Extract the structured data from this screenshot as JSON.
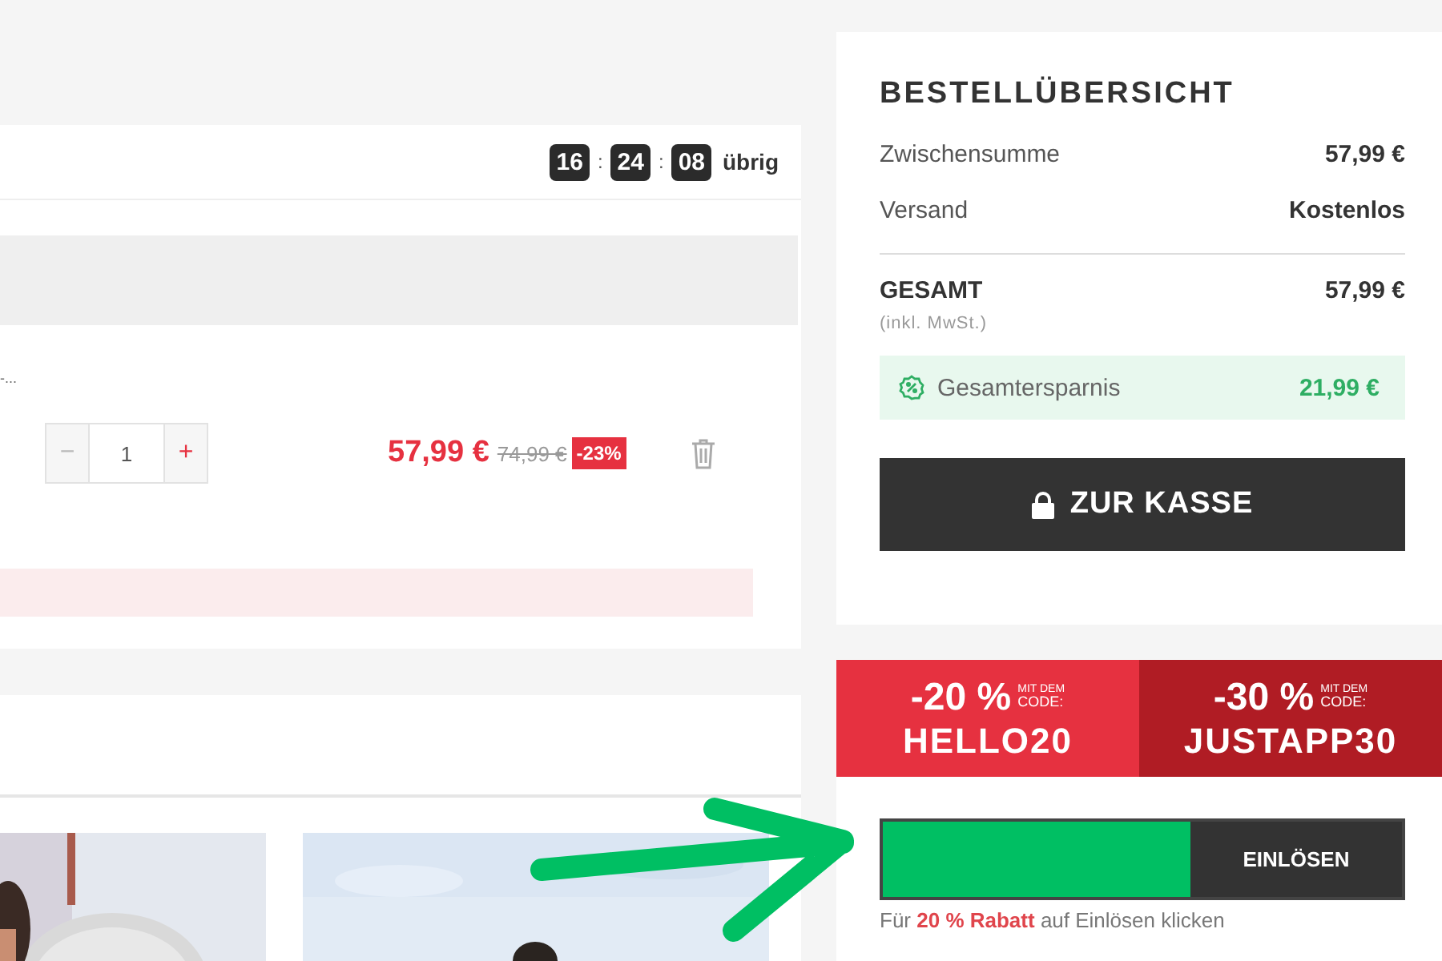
{
  "timer": {
    "hours": "16",
    "separator_1": ":",
    "minutes": "24",
    "separator_2": ":",
    "seconds": "08",
    "suffix": "übrig"
  },
  "cart_item": {
    "title_fragment": "-...",
    "minus": "−",
    "quantity": "1",
    "plus": "+",
    "price": "57,99 €",
    "old_price": "74,99 €",
    "discount": "-23%"
  },
  "summary": {
    "title": "BESTELLÜBERSICHT",
    "rows": [
      {
        "label": "Zwischensumme",
        "value": "57,99 €"
      },
      {
        "label": "Versand",
        "value": "Kostenlos"
      }
    ],
    "total": {
      "label": "GESAMT",
      "value": "57,99 €",
      "note": "(inkl. MwSt.)"
    },
    "savings": {
      "label": "Gesamtersparnis",
      "value": "21,99 €"
    },
    "checkout_button": "ZUR KASSE"
  },
  "promos": [
    {
      "percent": "-20 %",
      "small_1": "MIT DEM",
      "small_2": "CODE:",
      "code": "HELLO20",
      "color": "#e63140"
    },
    {
      "percent": "-30 %",
      "small_1": "MIT DEM",
      "small_2": "CODE:",
      "code": "JUSTAPP30",
      "color": "#b01c24"
    }
  ],
  "coupon": {
    "button": "EINLÖSEN",
    "hint": "Für **20 % Rabatt** auf Einlösen klicken"
  }
}
